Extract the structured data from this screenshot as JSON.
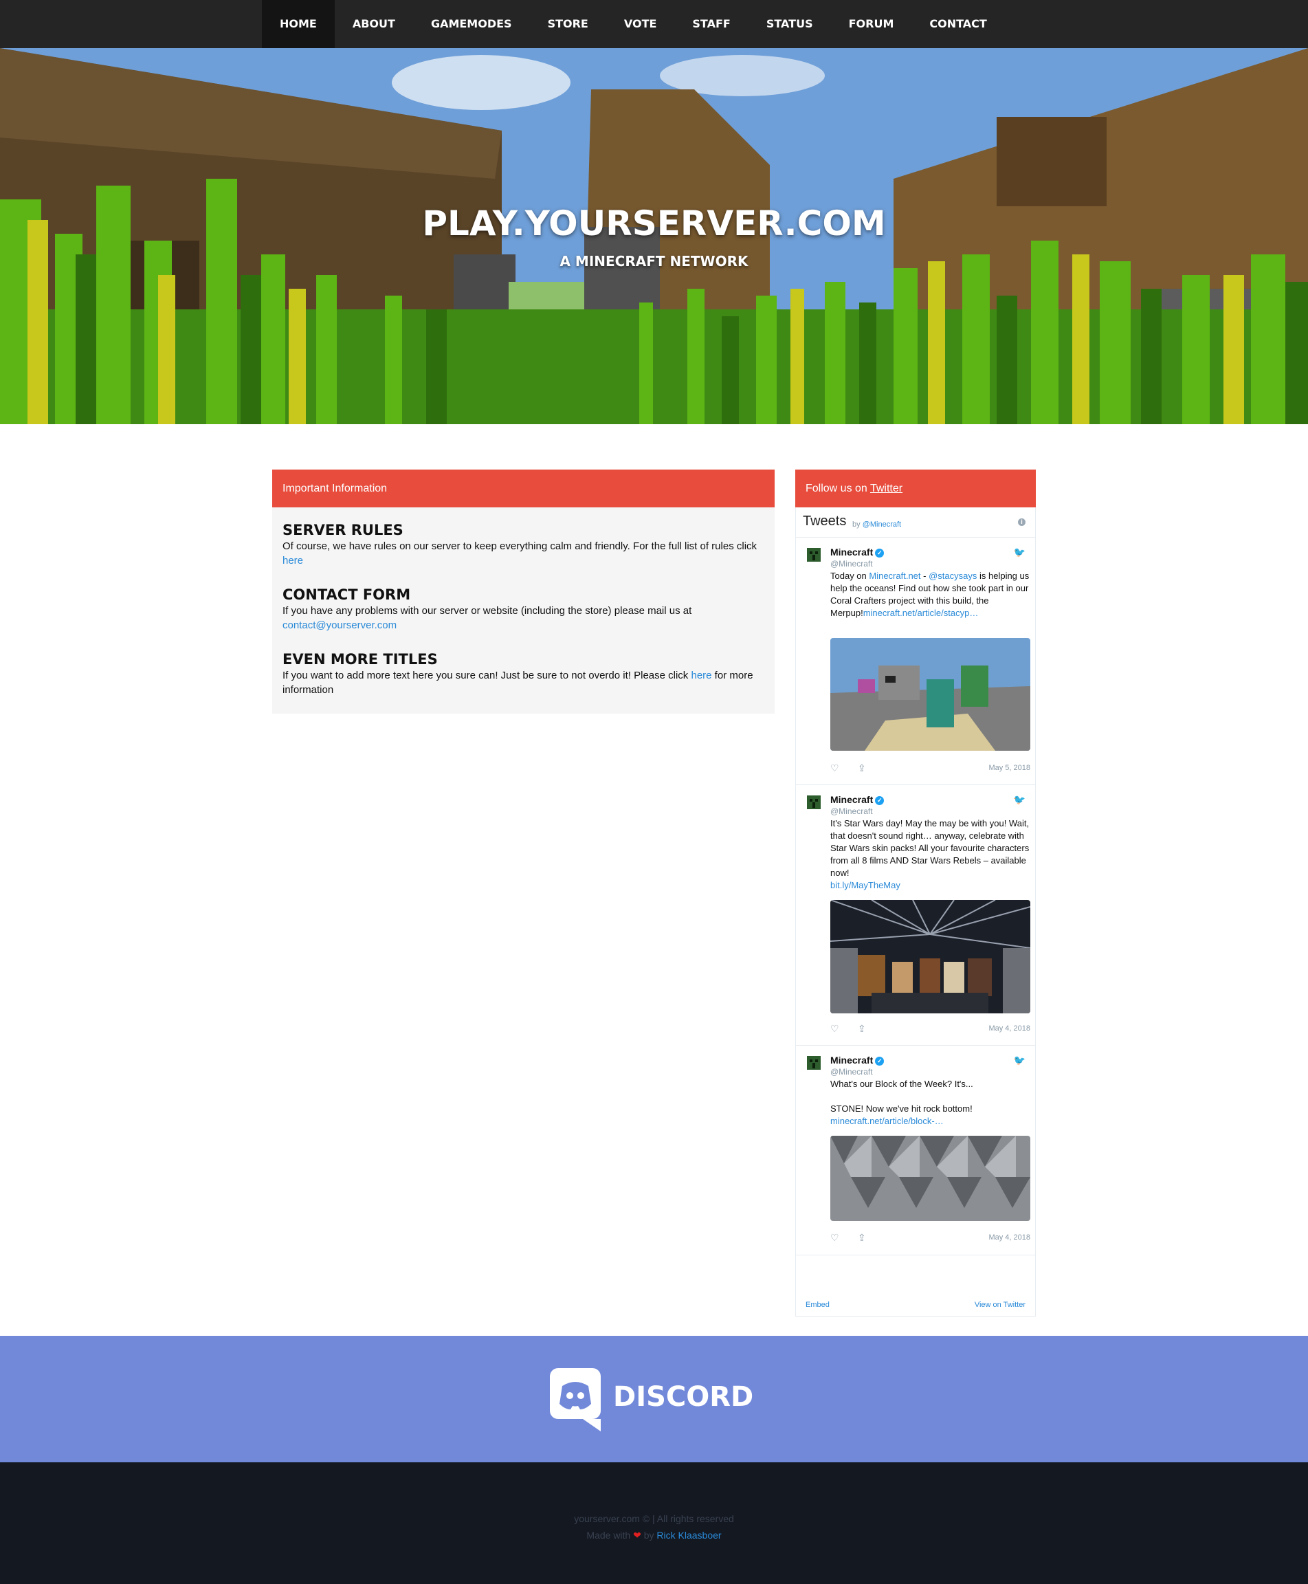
{
  "nav": {
    "items": [
      {
        "label": "HOME",
        "active": true
      },
      {
        "label": "ABOUT"
      },
      {
        "label": "GAMEMODES"
      },
      {
        "label": "STORE"
      },
      {
        "label": "VOTE"
      },
      {
        "label": "STAFF"
      },
      {
        "label": "STATUS"
      },
      {
        "label": "FORUM"
      },
      {
        "label": "CONTACT"
      }
    ]
  },
  "hero": {
    "title": "PLAY.YOURSERVER.COM",
    "subtitle": "A MINECRAFT NETWORK"
  },
  "info": {
    "header": "Important Information",
    "sections": [
      {
        "title": "SERVER RULES",
        "text": "Of course, we have rules on our server to keep everything calm and friendly. For the full list of rules click ",
        "link": "here",
        "after": ""
      },
      {
        "title": "CONTACT FORM",
        "text": "If you have any problems with our server or website (including the store) please mail us at ",
        "link": "contact@yourserver.com",
        "after": ""
      },
      {
        "title": "EVEN MORE TITLES",
        "text": "If you want to add more text here you sure can! Just be sure to not overdo it! Please click ",
        "link": "here",
        "after": " for more information"
      }
    ]
  },
  "twitter": {
    "header_prefix": "Follow us on ",
    "header_link": "Twitter",
    "widget_title": "Tweets",
    "widget_by": "by ",
    "widget_handle": "@Minecraft",
    "tweets": [
      {
        "name": "Minecraft",
        "handle": "@Minecraft",
        "text_parts": [
          "Today on ",
          "Minecraft.net",
          " - ",
          "@stacysays",
          " is helping us help the oceans! Find out how she took part in our Coral Crafters project with this build, the Merpup!",
          "minecraft.net/article/stacyp…"
        ],
        "date": "May 5, 2018"
      },
      {
        "name": "Minecraft",
        "handle": "@Minecraft",
        "text_parts": [
          "It's Star Wars day! May the may be with you! Wait, that doesn't sound right… anyway, celebrate with Star Wars skin packs! All your favourite characters from all 8 films AND Star Wars Rebels – available now!",
          "bit.ly/MayTheMay"
        ],
        "date": "May 4, 2018"
      },
      {
        "name": "Minecraft",
        "handle": "@Minecraft",
        "text_parts": [
          "What's our Block of the Week? It's...",
          "STONE! Now we've hit rock bottom!",
          "minecraft.net/article/block-…"
        ],
        "date": "May 4, 2018"
      }
    ],
    "footer_embed": "Embed",
    "footer_view": "View on Twitter"
  },
  "discord": {
    "label": "DISCORD",
    "color": "#7289da"
  },
  "footer": {
    "copyright": "yourserver.com © | All rights reserved",
    "made_prefix": "Made with ",
    "made_by": " by ",
    "author": "Rick Klaasboer"
  },
  "colors": {
    "accent": "#e74c3c",
    "nav_bg": "#252525",
    "footer_bg": "#131821",
    "link": "#2a8ad8"
  }
}
